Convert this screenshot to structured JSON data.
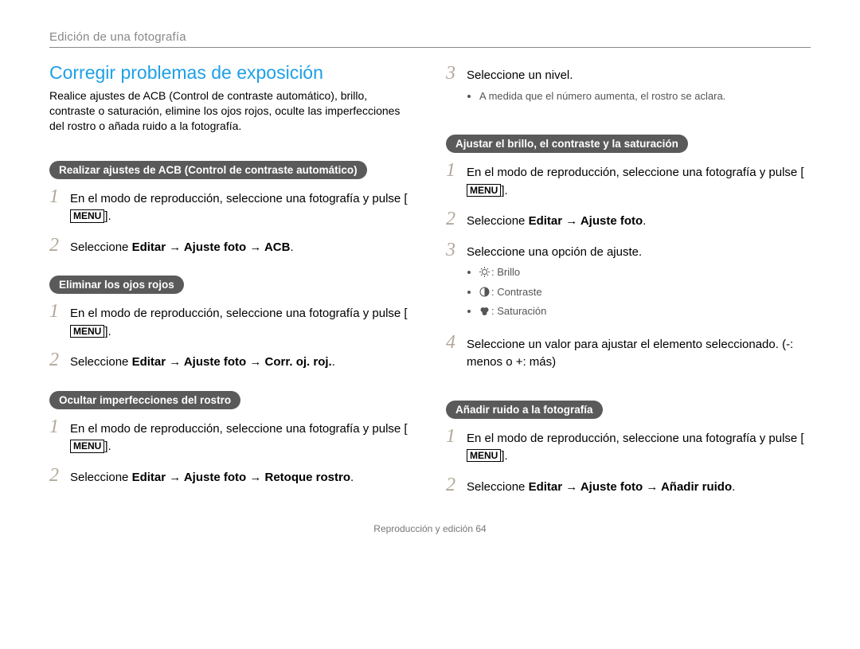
{
  "breadcrumb": "Edición de una fotografía",
  "title": "Corregir problemas de exposición",
  "intro": "Realice ajustes de ACB (Control de contraste automático), brillo, contraste o saturación, elimine los ojos rojos, oculte las imperfecciones del rostro o añada ruido a la fotografía.",
  "footer": "Reproducción y edición  64",
  "menuLabel": "MENU",
  "sections": {
    "acb": {
      "heading": "Realizar ajustes de ACB (Control de contraste automático)",
      "step1_pre": "En el modo de reproducción, seleccione una fotografía y pulse [",
      "step1_post": "].",
      "step2_pre": "Seleccione ",
      "step2_bold": "Editar → Ajuste foto → ACB",
      "step2_post": "."
    },
    "redeye": {
      "heading": "Eliminar los ojos rojos",
      "step1_pre": "En el modo de reproducción, seleccione una fotografía y pulse [",
      "step1_post": "].",
      "step2_pre": "Seleccione ",
      "step2_bold": "Editar → Ajuste foto → Corr. oj. roj.",
      "step2_post": "."
    },
    "face": {
      "heading": "Ocultar imperfecciones del rostro",
      "step1_pre": "En el modo de reproducción, seleccione una fotografía y pulse [",
      "step1_post": "].",
      "step2_pre": "Seleccione ",
      "step2_bold": "Editar → Ajuste foto → Retoque rostro",
      "step2_post": "."
    },
    "level": {
      "step3": "Seleccione un nivel.",
      "bullet": "A medida que el número aumenta, el rostro se aclara."
    },
    "bcs": {
      "heading": "Ajustar el brillo, el contraste y la saturación",
      "step1_pre": "En el modo de reproducción, seleccione una fotografía y pulse [",
      "step1_post": "].",
      "step2_pre": "Seleccione ",
      "step2_bold": "Editar → Ajuste foto",
      "step2_post": ".",
      "step3": "Seleccione una opción de ajuste.",
      "opt_brightness": ": Brillo",
      "opt_contrast": ": Contraste",
      "opt_saturation": ": Saturación",
      "step4": "Seleccione un valor para ajustar el elemento seleccionado. (-: menos o +: más)"
    },
    "noise": {
      "heading": "Añadir ruido a la fotografía",
      "step1_pre": "En el modo de reproducción, seleccione una fotografía y pulse [",
      "step1_post": "].",
      "step2_pre": "Seleccione ",
      "step2_bold": "Editar → Ajuste foto → Añadir ruido",
      "step2_post": "."
    }
  }
}
